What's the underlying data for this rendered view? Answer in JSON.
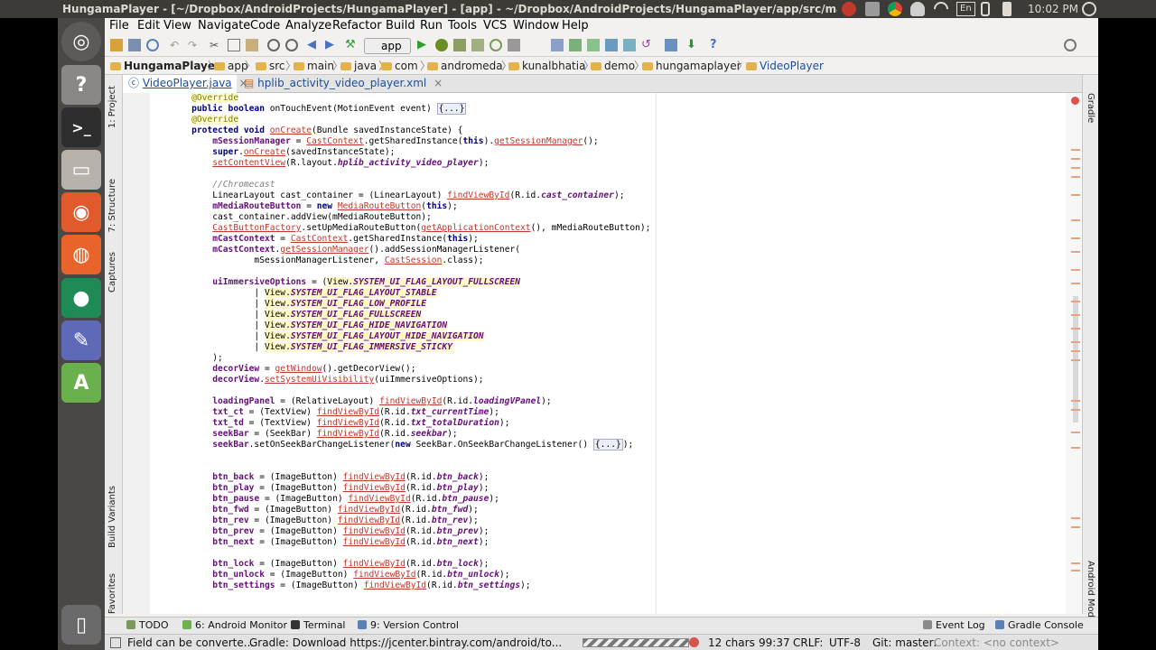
{
  "topbar": {
    "title": "HungamaPlayer - [~/Dropbox/AndroidProjects/HungamaPlayer] - [app] - ~/Dropbox/AndroidProjects/HungamaPlayer/app/src/main/java/com/andromeda",
    "lang": "En",
    "clock": "10:02 PM"
  },
  "menu": [
    "File",
    "Edit",
    "View",
    "Navigate",
    "Code",
    "Analyze",
    "Refactor",
    "Build",
    "Run",
    "Tools",
    "VCS",
    "Window",
    "Help"
  ],
  "toolbar": {
    "run_config": "app"
  },
  "breadcrumb": [
    "HungamaPlayer",
    "app",
    "src",
    "main",
    "java",
    "com",
    "andromeda",
    "kunalbhatia",
    "demo",
    "hungamaplayer",
    "VideoPlayer"
  ],
  "tabs": [
    {
      "label": "VideoPlayer.java"
    },
    {
      "label": "hplib_activity_video_player.xml"
    }
  ],
  "left_tools": [
    "1: Project",
    "7: Structure",
    "Captures",
    "Build Variants",
    "2: Favorites"
  ],
  "right_tools": [
    "Gradle",
    "Android Model"
  ],
  "code_lines": [
    "    @Override",
    "    public boolean onTouchEvent(MotionEvent event) {...}",
    "    @Override",
    "    protected void onCreate(Bundle savedInstanceState) {",
    "        mSessionManager = CastContext.getSharedInstance(this).getSessionManager();",
    "        super.onCreate(savedInstanceState);",
    "        setContentView(R.layout.hplib_activity_video_player);",
    "",
    "        //Chromecast",
    "        LinearLayout cast_container = (LinearLayout) findViewById(R.id.cast_container);",
    "        mMediaRouteButton = new MediaRouteButton(this);",
    "        cast_container.addView(mMediaRouteButton);",
    "        CastButtonFactory.setUpMediaRouteButton(getApplicationContext(), mMediaRouteButton);",
    "        mCastContext = CastContext.getSharedInstance(this);",
    "        mCastContext.getSessionManager().addSessionManagerListener(",
    "                mSessionManagerListener, CastSession.class);",
    "",
    "        uiImmersiveOptions = (View.SYSTEM_UI_FLAG_LAYOUT_FULLSCREEN",
    "                | View.SYSTEM_UI_FLAG_LAYOUT_STABLE",
    "                | View.SYSTEM_UI_FLAG_LOW_PROFILE",
    "                | View.SYSTEM_UI_FLAG_FULLSCREEN",
    "                | View.SYSTEM_UI_FLAG_HIDE_NAVIGATION",
    "                | View.SYSTEM_UI_FLAG_LAYOUT_HIDE_NAVIGATION",
    "                | View.SYSTEM_UI_FLAG_IMMERSIVE_STICKY",
    "        );",
    "        decorView = getWindow().getDecorView();",
    "        decorView.setSystemUiVisibility(uiImmersiveOptions);",
    "",
    "        loadingPanel = (RelativeLayout) findViewById(R.id.loadingVPanel);",
    "        txt_ct = (TextView) findViewById(R.id.txt_currentTime);",
    "        txt_td = (TextView) findViewById(R.id.txt_totalDuration);",
    "        seekBar = (SeekBar) findViewById(R.id.seekbar);",
    "        seekBar.setOnSeekBarChangeListener(new SeekBar.OnSeekBarChangeListener() {...});",
    "",
    "",
    "        btn_back = (ImageButton) findViewById(R.id.btn_back);",
    "        btn_play = (ImageButton) findViewById(R.id.btn_play);",
    "        btn_pause = (ImageButton) findViewById(R.id.btn_pause);",
    "        btn_fwd = (ImageButton) findViewById(R.id.btn_fwd);",
    "        btn_rev = (ImageButton) findViewById(R.id.btn_rev);",
    "        btn_prev = (ImageButton) findViewById(R.id.btn_prev);",
    "        btn_next = (ImageButton) findViewById(R.id.btn_next);",
    "",
    "        btn_lock = (ImageButton) findViewById(R.id.btn_lock);",
    "        btn_unlock = (ImageButton) findViewById(R.id.btn_unlock);",
    "        btn_settings = (ImageButton) findViewById(R.id.btn_settings);"
  ],
  "bottom_tools": {
    "todo": "TODO",
    "monitor": "6: Android Monitor",
    "terminal": "Terminal",
    "vcs": "9: Version Control",
    "event_log": "Event Log",
    "gradle_console": "Gradle Console"
  },
  "status": {
    "message": "Field can be converte...",
    "gradle": "Gradle: Download https://jcenter.bintray.com/android/to...",
    "chars": "12 chars",
    "position": "99:37",
    "line_sep": "CRLF:",
    "encoding": "UTF-8",
    "git": "Git: master:",
    "context": "Context: <no context>"
  },
  "colors": {
    "keyword": "#000080",
    "annotation": "#808000",
    "field": "#660e7a",
    "error_underline": "#c0392b",
    "comment": "#808080"
  }
}
